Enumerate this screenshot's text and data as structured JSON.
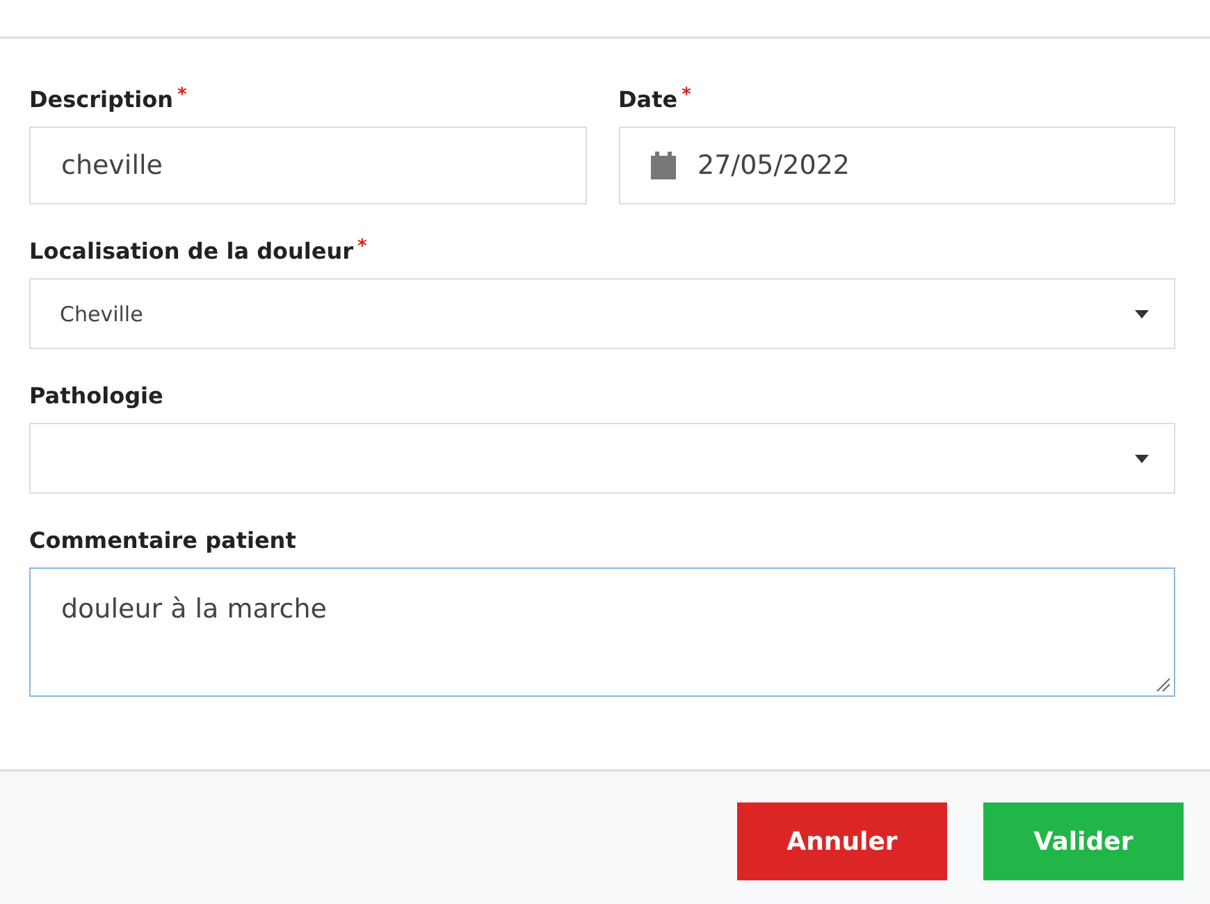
{
  "form": {
    "rows": [
      {
        "fields": [
          {
            "kind": "text",
            "label": "Description",
            "required_mark": "*",
            "value": "cheville",
            "focused": false
          },
          {
            "kind": "date",
            "label": "Date",
            "required_mark": "*",
            "value": "27/05/2022",
            "focused": false
          }
        ]
      },
      {
        "fields": [
          {
            "kind": "select",
            "label": "Localisation de la douleur",
            "required_mark": "*",
            "value": "Cheville",
            "focused": false
          }
        ]
      },
      {
        "fields": [
          {
            "kind": "select",
            "label": "Pathologie",
            "focused": false
          }
        ]
      },
      {
        "fields": [
          {
            "kind": "textarea",
            "label": "Commentaire patient",
            "value": "douleur à la marche",
            "focused": true
          }
        ]
      }
    ]
  },
  "footer": {
    "buttons": [
      {
        "label": "Annuler",
        "kind": "cancel"
      },
      {
        "label": "Valider",
        "kind": "confirm"
      }
    ]
  }
}
